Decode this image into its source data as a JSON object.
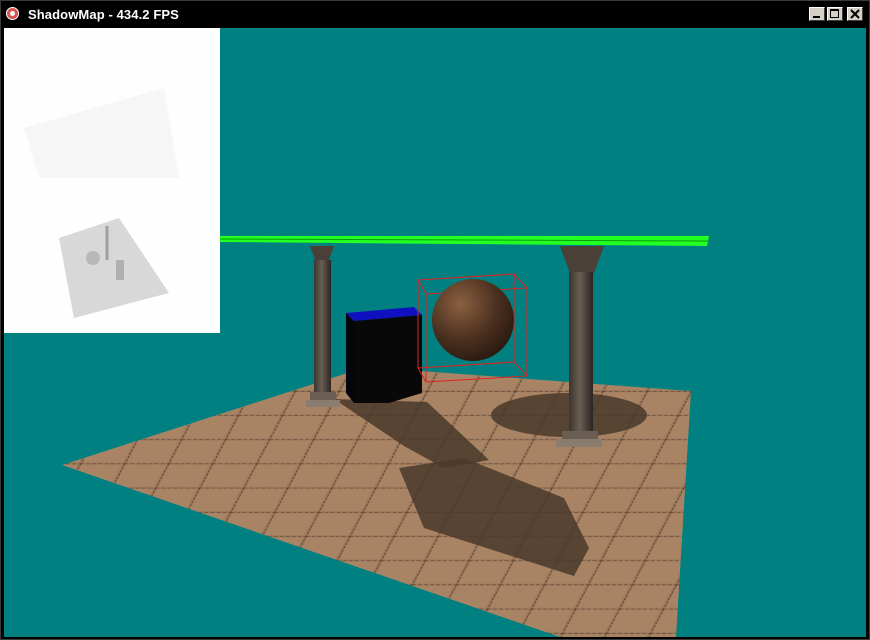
{
  "window": {
    "title": "ShadowMap - 434.2 FPS",
    "icon": "app-icon",
    "controls": [
      "minimize-icon",
      "maximize-icon",
      "close-icon"
    ]
  },
  "scene": {
    "background_color": "#008080",
    "objects": [
      "floor",
      "column-left",
      "column-right",
      "green-beam",
      "blue-box",
      "sphere",
      "bounding-box"
    ],
    "colors": {
      "beam": "#22ff22",
      "box_top": "#1010c0",
      "bounding_box": "#e02020",
      "floor": "#9c7a5e"
    }
  },
  "shadowmap_preview": {
    "background_color": "#ffffff"
  }
}
